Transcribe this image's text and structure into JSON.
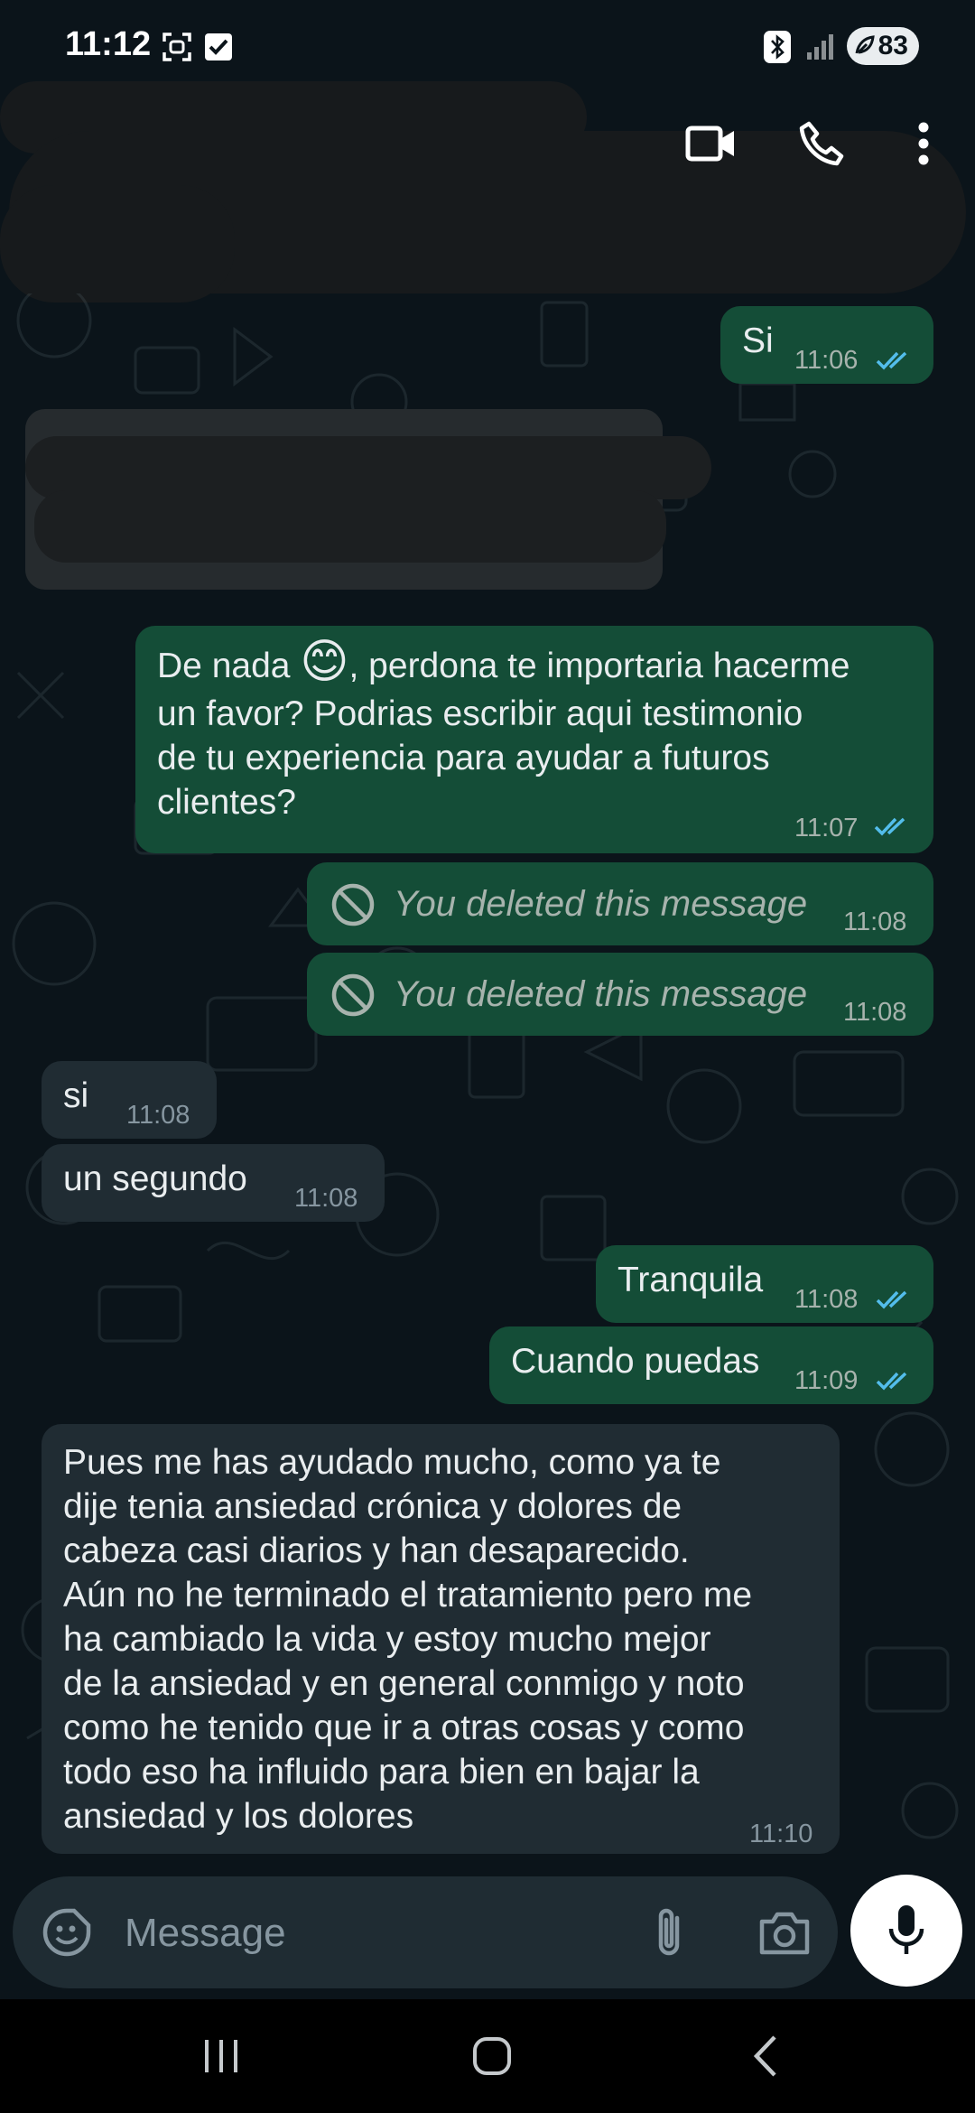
{
  "status_bar": {
    "time": "11:12",
    "battery": "83"
  },
  "header": {
    "contact_name": "",
    "video_call_icon": "video-camera-icon",
    "voice_call_icon": "phone-icon",
    "menu_icon": "more-vertical-icon"
  },
  "messages": [
    {
      "direction": "out",
      "text": "Si",
      "time": "11:06",
      "status": "read"
    },
    {
      "direction": "in",
      "text": "",
      "time": "",
      "redacted": true
    },
    {
      "direction": "out",
      "text_before_emoji": "De nada ",
      "emoji": "😊",
      "text_after_emoji": ", perdona te importaria hacerme",
      "lines": [
        "un favor? Podrias escribir aqui testimonio",
        "de tu experiencia para ayudar a futuros",
        "clientes?"
      ],
      "time": "11:07",
      "status": "read"
    },
    {
      "direction": "out",
      "deleted": true,
      "text": "You deleted this message",
      "time": "11:08"
    },
    {
      "direction": "out",
      "deleted": true,
      "text": "You deleted this message",
      "time": "11:08"
    },
    {
      "direction": "in",
      "text": "si",
      "time": "11:08"
    },
    {
      "direction": "in",
      "text": "un segundo",
      "time": "11:08"
    },
    {
      "direction": "out",
      "text": "Tranquila",
      "time": "11:08",
      "status": "read"
    },
    {
      "direction": "out",
      "text": "Cuando puedas",
      "time": "11:09",
      "status": "read"
    },
    {
      "direction": "in",
      "lines": [
        "Pues me has ayudado mucho, como ya te",
        "dije tenia ansiedad crónica y dolores de",
        "cabeza casi diarios y han desaparecido.",
        "Aún no he terminado el tratamiento pero me",
        "ha cambiado la vida y estoy mucho mejor",
        "de la ansiedad y en general conmigo y noto",
        "como he tenido que ir a otras cosas y como",
        "todo eso ha influido para bien en bajar la",
        "ansiedad y los dolores"
      ],
      "time": "11:10"
    }
  ],
  "composer": {
    "placeholder": "Message",
    "emoji_icon": "sticker-smiley-icon",
    "attach_icon": "paperclip-icon",
    "camera_icon": "camera-icon",
    "mic_icon": "microphone-icon"
  },
  "navigation": {
    "recents_icon": "recent-apps-icon",
    "home_icon": "home-icon",
    "back_icon": "back-icon"
  },
  "colors": {
    "background": "#0b141a",
    "outgoing_bubble": "#144d37",
    "incoming_bubble": "#202c33",
    "read_tick": "#53bdeb"
  }
}
